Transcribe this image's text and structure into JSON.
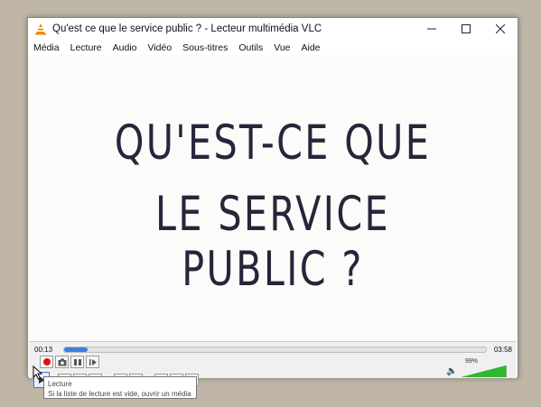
{
  "window": {
    "title": "Qu'est ce que le service public ? - Lecteur multimédia VLC",
    "controls": [
      "minimize-icon",
      "maximize-icon",
      "close-icon"
    ]
  },
  "menu": [
    "Média",
    "Lecture",
    "Audio",
    "Vidéo",
    "Sous-titres",
    "Outils",
    "Vue",
    "Aide"
  ],
  "video": {
    "line1": "QU'EST-CE QUE",
    "line2": "LE SERVICE PUBLIC ?"
  },
  "player": {
    "elapsed": "00:13",
    "total": "03:58",
    "progress_fraction": 0.056,
    "volume_label": "99%",
    "volume_fraction": 0.99,
    "accent_color": "#3d7fe0",
    "record_color": "#e01010",
    "volume_color": "#2db82d"
  },
  "tooltip": {
    "title": "Lecture",
    "text": "Si la liste de lecture est vide, ouvrir un média"
  }
}
